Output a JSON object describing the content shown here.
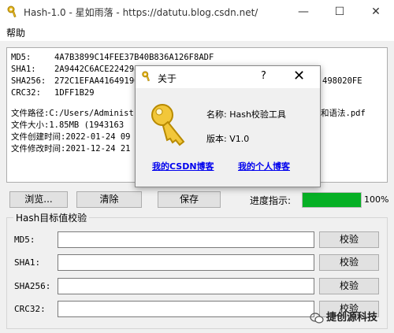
{
  "window": {
    "title": "Hash-1.0 - 星如雨落 - https://datutu.blog.csdn.net/",
    "minimize_glyph": "—",
    "maximize_glyph": "☐",
    "close_glyph": "✕"
  },
  "menu": {
    "help": "帮助"
  },
  "output": {
    "lines": [
      {
        "label": "MD5:",
        "value": "4A7B3899C14FEE37B40B836A126F8ADF"
      },
      {
        "label": "SHA1:",
        "value": "2A9442C6ACE224298"
      },
      {
        "label": "SHA256:",
        "value": "272C1EFAA41649196",
        "tail": "498020FE"
      },
      {
        "label": "CRC32:",
        "value": "1DFF1B29"
      }
    ],
    "file_path_label": "文件路径:C:/Users/Administ",
    "file_path_tail": "和语法.pdf",
    "file_size": "文件大小:1.85MB   (1943163",
    "file_created": "文件创建时间:2022-01-24 09",
    "file_modified": "文件修改时间:2021-12-24 21"
  },
  "toolbar": {
    "browse": "浏览...",
    "clear": "清除",
    "save": "保存",
    "progress_label": "进度指示:",
    "progress_value": 1.0,
    "progress_percent": "100%"
  },
  "verify": {
    "group_title": "Hash目标值校验",
    "fields": [
      {
        "label": "MD5:",
        "button": "校验"
      },
      {
        "label": "SHA1:",
        "button": "校验"
      },
      {
        "label": "SHA256:",
        "button": "校验"
      },
      {
        "label": "CRC32:",
        "button": "校验"
      }
    ]
  },
  "about": {
    "title": "关于",
    "help": "?",
    "close": "✕",
    "name": "名称: Hash校验工具",
    "version": "版本: V1.0",
    "link_csdn": "我的CSDN博客",
    "link_personal": "我的个人博客"
  },
  "watermark": "捷创源科技",
  "colors": {
    "progress_fill": "#06b025",
    "link": "#0000ee",
    "key_icon": "#e8b820"
  }
}
